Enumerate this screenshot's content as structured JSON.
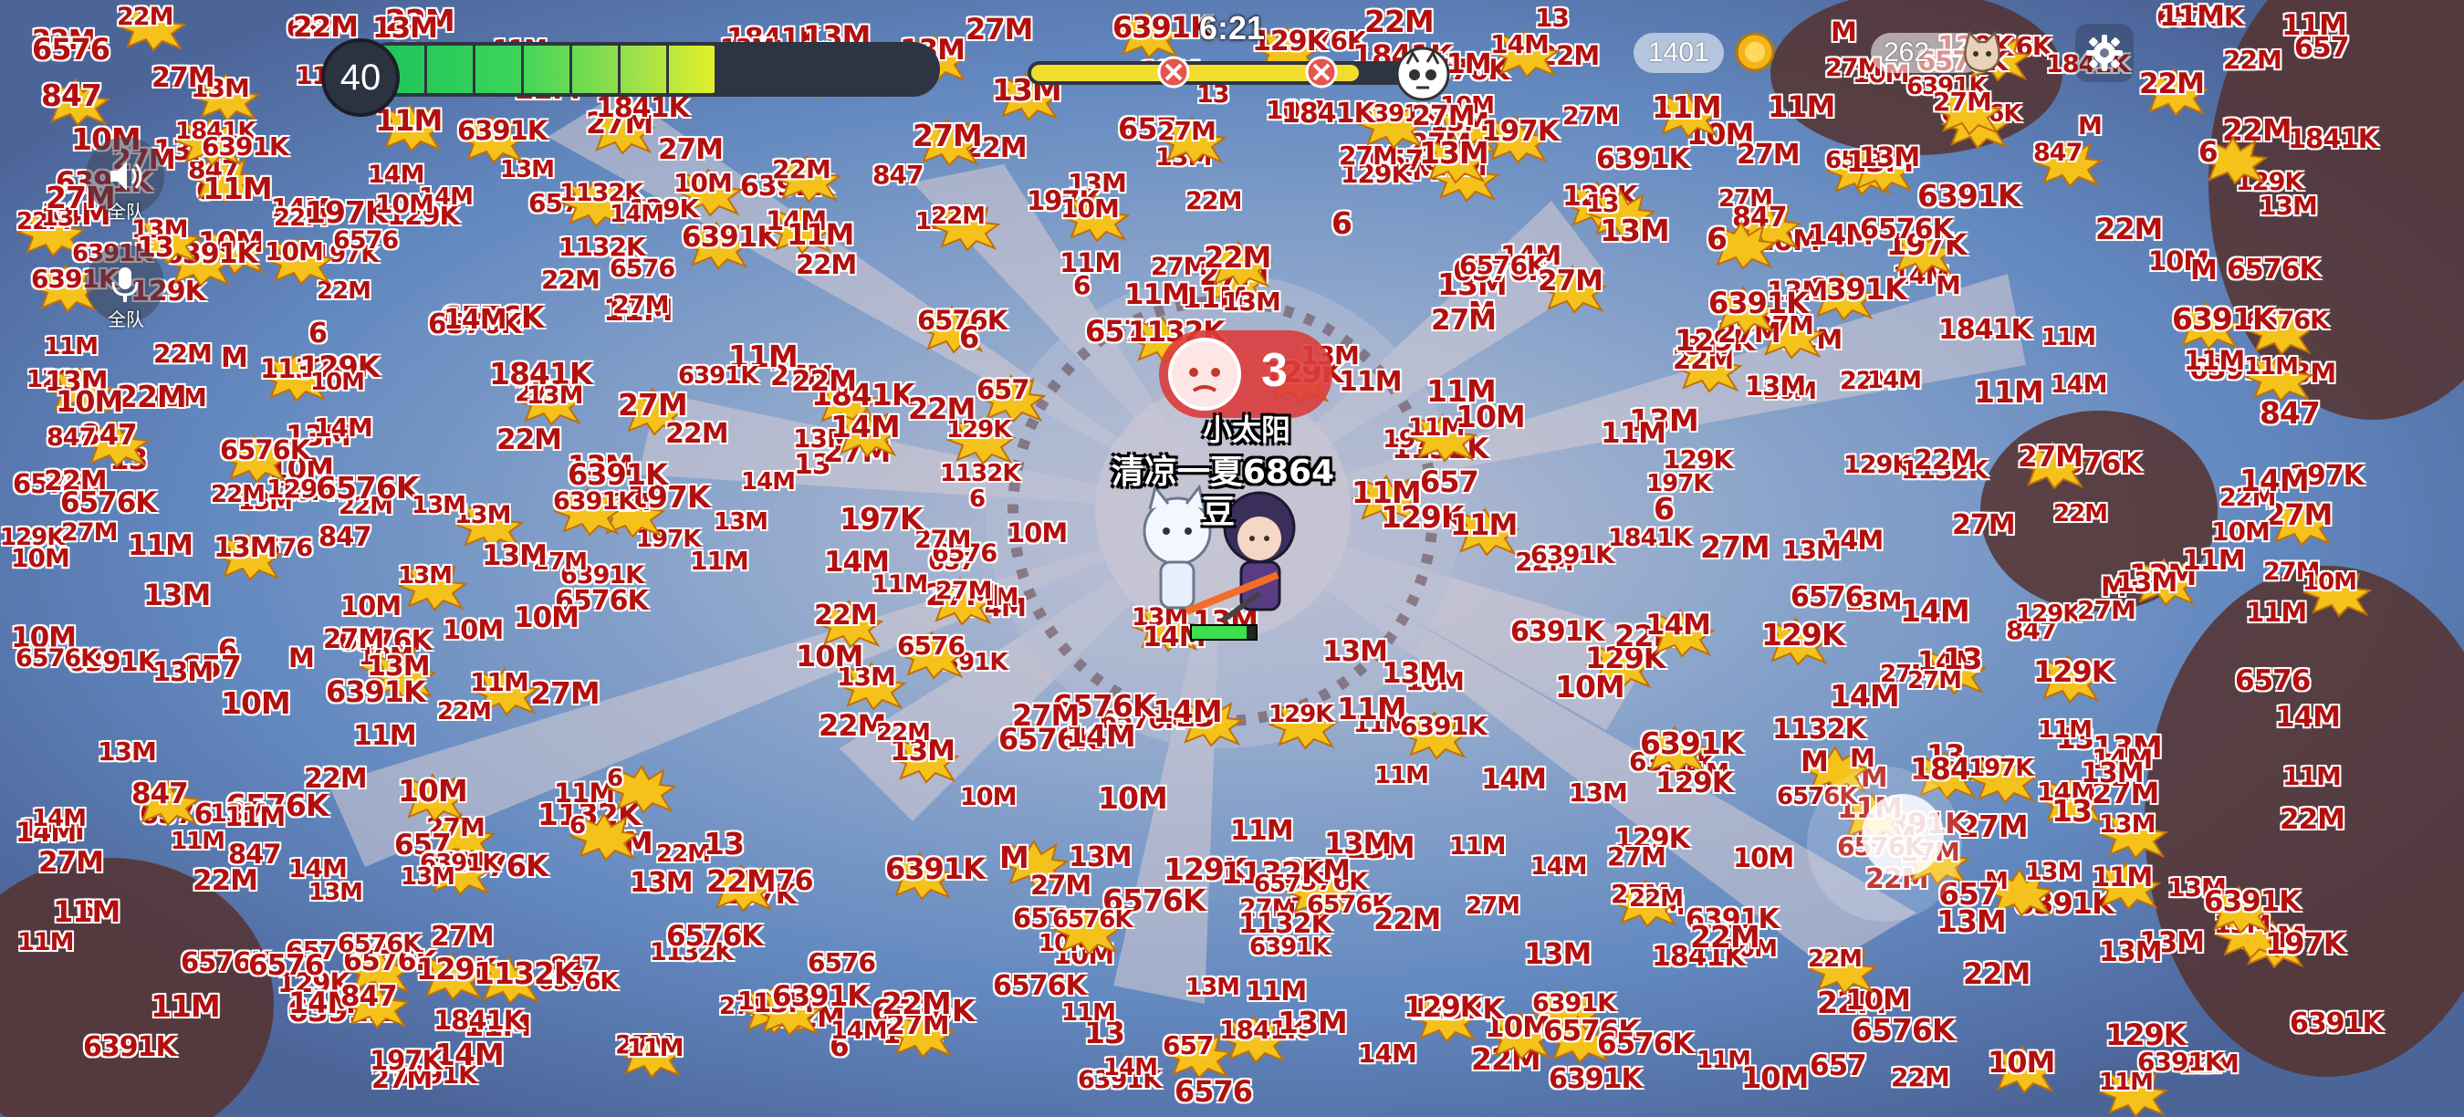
{
  "hud": {
    "level": "40",
    "xp_progress": 0.62,
    "timer": "6:21",
    "boss_progress": 0.86,
    "kills": "1401",
    "gems": "262"
  },
  "side_buttons": {
    "speaker_label": "全队",
    "mic_label": "全队"
  },
  "players": {
    "emote_count": "3",
    "name_1": "小太阳",
    "name_2": "清凉一夏6864",
    "name_3": "豆"
  },
  "icons": {
    "speaker": "speaker-icon",
    "mic": "microphone-icon",
    "settings": "gear-icon",
    "coin": "coin-icon",
    "cat": "cat-icon",
    "boss": "skull-icon"
  },
  "colors": {
    "damage_text": "#b30f0f",
    "burst": "#f4c21a",
    "xp_start": "#1ec45a",
    "xp_end": "#e5f02a",
    "boss_fill": "#f2dd2e"
  },
  "damage_numbers": [
    "13M",
    "6576K",
    "22M",
    "27M",
    "11M",
    "10M",
    "14M",
    "6391K",
    "129K",
    "1841K",
    "847",
    "1132K",
    "197K",
    "13",
    "6",
    "657",
    "6576",
    "M",
    "13M",
    "6576K",
    "22M",
    "27M",
    "11M",
    "10M",
    "14M",
    "6391K",
    "13M",
    "22M",
    "27M",
    "13M",
    "11M",
    "6576K",
    "10M",
    "14M",
    "22M",
    "27M",
    "13M",
    "6391K",
    "11M",
    "129K"
  ]
}
